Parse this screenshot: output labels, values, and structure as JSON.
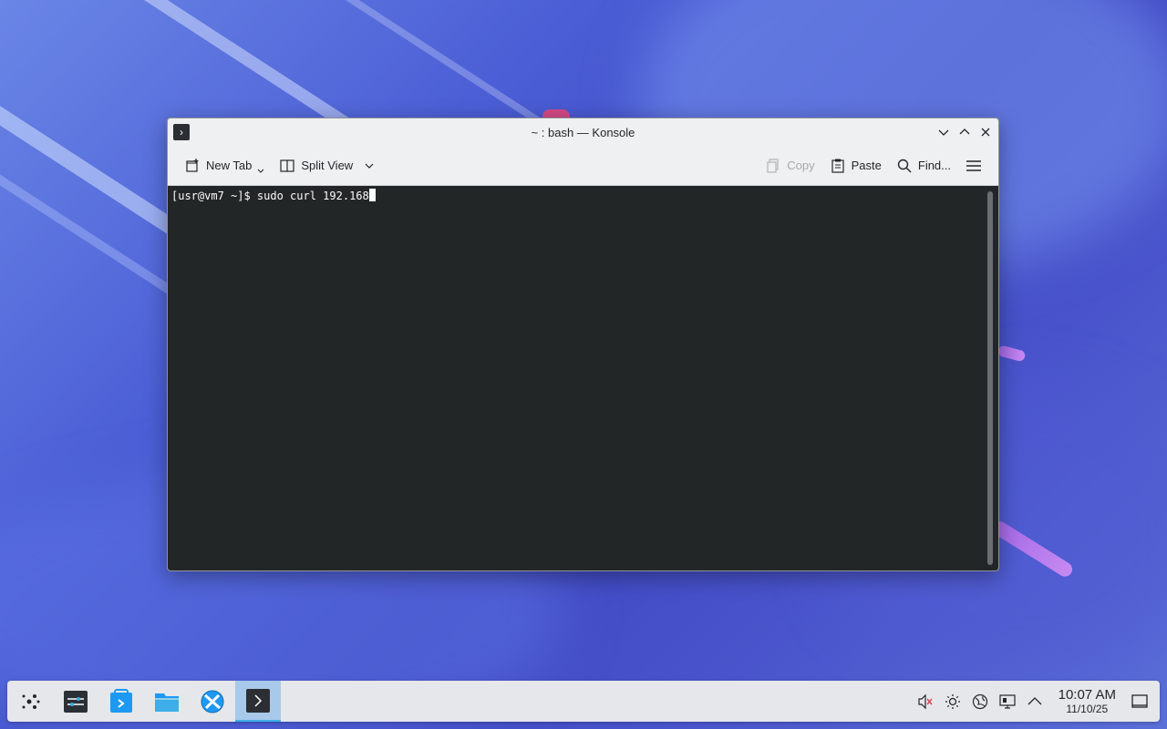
{
  "window": {
    "title": "~ : bash — Konsole"
  },
  "toolbar": {
    "new_tab": "New Tab",
    "split_view": "Split View",
    "copy": "Copy",
    "paste": "Paste",
    "find": "Find..."
  },
  "terminal": {
    "prompt_line": "[usr@vm7 ~]$ sudo curl 192.168"
  },
  "taskbar": {
    "time": "10:07 AM",
    "date": "11/10/25"
  },
  "colors": {
    "terminal_bg": "#232627",
    "accent": "#3daee9"
  }
}
